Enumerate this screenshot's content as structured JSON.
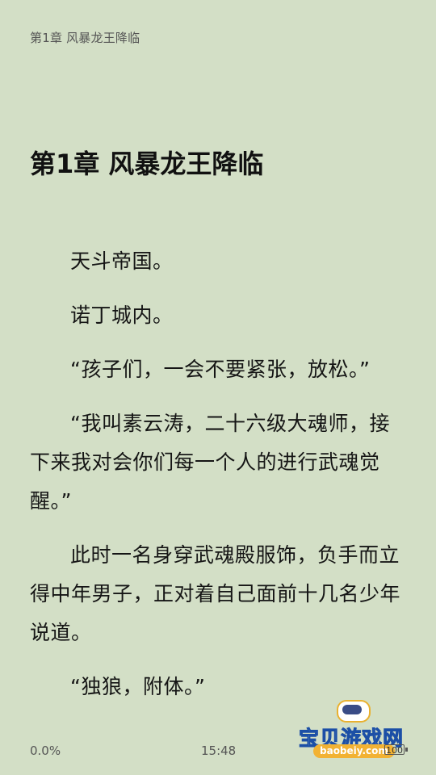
{
  "header": {
    "chapter_label": "第1章 风暴龙王降临"
  },
  "chapter": {
    "title": "第1章 风暴龙王降临"
  },
  "content": {
    "paragraphs": [
      "天斗帝国。",
      "诺丁城内。",
      "“孩子们，一会不要紧张，放松。”",
      "“我叫素云涛，二十六级大魂师，接下来我对会你们每一个人的进行武魂觉醒。”",
      "此时一名身穿武魂殿服饰，负手而立得中年男子，正对着自己面前十几名少年说道。",
      "“独狼，附体。”"
    ]
  },
  "footer": {
    "progress": "0.0%",
    "time": "15:48",
    "battery": "100"
  },
  "watermark": {
    "name": "宝贝游戏网",
    "url": "baobeiy.com"
  }
}
